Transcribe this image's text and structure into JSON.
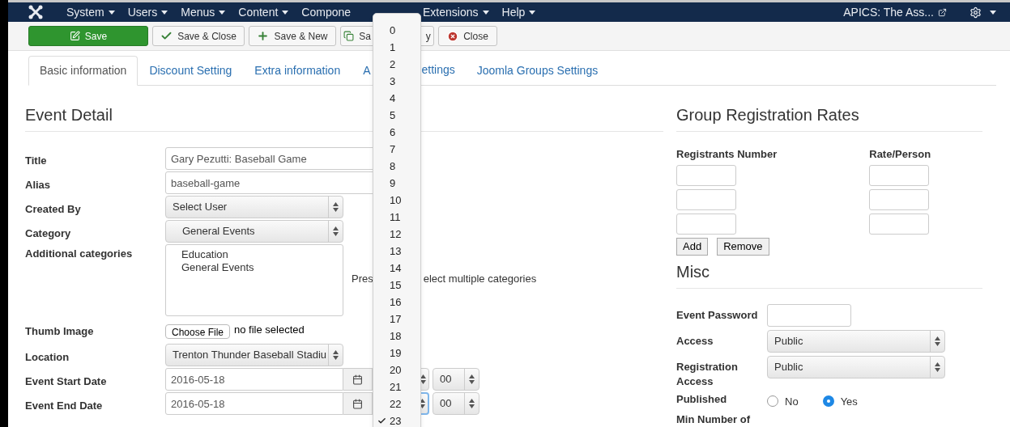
{
  "navbar": {
    "menus": [
      {
        "label": "System",
        "caret": true
      },
      {
        "label": "Users",
        "caret": true
      },
      {
        "label": "Menus",
        "caret": true
      },
      {
        "label": "Content",
        "caret": true
      },
      {
        "label": "Compone",
        "caret": false
      },
      {
        "label": "Extensions",
        "caret": true
      },
      {
        "label": "Help",
        "caret": true
      }
    ],
    "site_link": "APICS: The Ass..."
  },
  "toolbar": [
    {
      "kind": "save",
      "label": "Save"
    },
    {
      "kind": "save-close",
      "label": "Save & Close"
    },
    {
      "kind": "save-new",
      "label": "Save & New"
    },
    {
      "kind": "save-copy",
      "label": "Sa",
      "label_tail": "y"
    },
    {
      "kind": "close",
      "label": "Close"
    }
  ],
  "tabs": [
    {
      "label": "Basic information",
      "selected": true
    },
    {
      "label": "Discount Setting",
      "selected": false
    },
    {
      "label": "Extra information",
      "selected": false
    },
    {
      "label": "A",
      "label_tail": "ettings",
      "selected": false
    },
    {
      "label": "Joomla Groups Settings",
      "selected": false
    }
  ],
  "event_detail": {
    "heading": "Event Detail",
    "fields": [
      {
        "kind": "text",
        "label": "Title",
        "value": "Gary Pezutti: Baseball Game"
      },
      {
        "kind": "text",
        "label": "Alias",
        "value": "baseball-game"
      },
      {
        "kind": "select",
        "label": "Created By",
        "value": "Select User",
        "indented": false
      },
      {
        "kind": "select",
        "label": "Category",
        "value": "General Events",
        "indented": true
      },
      {
        "kind": "multiselect",
        "label": "Additional categories",
        "options": [
          "Education",
          "General Events"
        ],
        "help": "Pres",
        "help_tail": "elect multiple categories"
      },
      {
        "kind": "file",
        "label": "Thumb Image",
        "button": "Choose File",
        "status": "no file selected"
      },
      {
        "kind": "select",
        "label": "Location",
        "value": "Trenton Thunder Baseball Stadiu",
        "indented": false
      },
      {
        "kind": "date",
        "label": "Event Start Date",
        "value": "2016-05-18",
        "minute": "00",
        "focused": false
      },
      {
        "kind": "date",
        "label": "Event End Date",
        "value": "2016-05-18",
        "minute": "00",
        "focused": true
      }
    ]
  },
  "group_rates": {
    "heading": "Group Registration Rates",
    "columns": [
      "Registrants Number",
      "Rate/Person"
    ],
    "buttons": [
      "Add",
      "Remove"
    ]
  },
  "misc": {
    "heading": "Misc",
    "fields": [
      {
        "kind": "text",
        "label": "Event Password"
      },
      {
        "kind": "select",
        "label": "Access",
        "value": "Public"
      },
      {
        "kind": "select",
        "label": "Registration Access",
        "value": "Public"
      },
      {
        "kind": "radio",
        "label": "Published",
        "options": [
          {
            "label": "No",
            "selected": false
          },
          {
            "label": "Yes",
            "selected": true
          }
        ]
      },
      {
        "kind": "label",
        "label": "Min Number of"
      }
    ]
  },
  "hour_menu": [
    {
      "label": "0",
      "checked": false
    },
    {
      "label": "1",
      "checked": false
    },
    {
      "label": "2",
      "checked": false
    },
    {
      "label": "3",
      "checked": false
    },
    {
      "label": "4",
      "checked": false
    },
    {
      "label": "5",
      "checked": false
    },
    {
      "label": "6",
      "checked": false
    },
    {
      "label": "7",
      "checked": false
    },
    {
      "label": "8",
      "checked": false
    },
    {
      "label": "9",
      "checked": false
    },
    {
      "label": "10",
      "checked": false
    },
    {
      "label": "11",
      "checked": false
    },
    {
      "label": "12",
      "checked": false
    },
    {
      "label": "13",
      "checked": false
    },
    {
      "label": "14",
      "checked": false
    },
    {
      "label": "15",
      "checked": false
    },
    {
      "label": "16",
      "checked": false
    },
    {
      "label": "17",
      "checked": false
    },
    {
      "label": "18",
      "checked": false
    },
    {
      "label": "19",
      "checked": false
    },
    {
      "label": "20",
      "checked": false
    },
    {
      "label": "21",
      "checked": false
    },
    {
      "label": "22",
      "checked": false
    },
    {
      "label": "23",
      "checked": true
    }
  ]
}
